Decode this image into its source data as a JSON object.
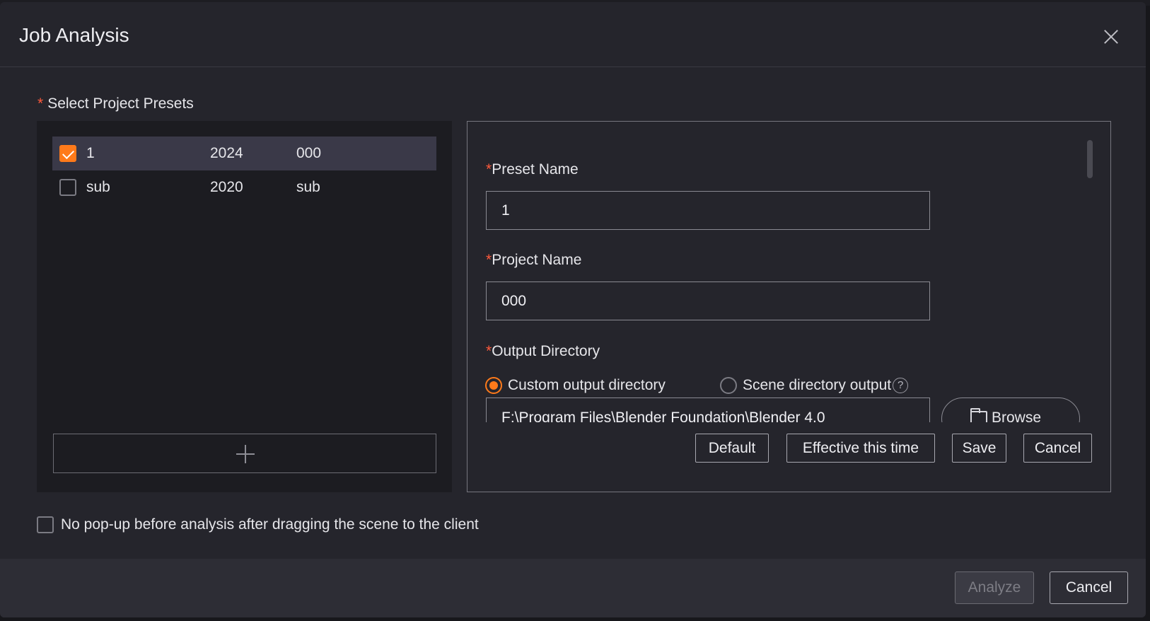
{
  "dialog": {
    "title": "Job Analysis",
    "close_icon": "close-icon"
  },
  "presets": {
    "section_label": "Select Project Presets",
    "required_marker": "*",
    "rows": [
      {
        "name": "1",
        "year": "2024",
        "project": "000",
        "checked": true
      },
      {
        "name": "sub",
        "year": "2020",
        "project": "sub",
        "checked": false
      }
    ],
    "add_icon": "plus-icon"
  },
  "editor": {
    "required_marker": "*",
    "preset_name_label": "Preset Name",
    "preset_name_value": "1",
    "project_name_label": "Project Name",
    "project_name_value": "000",
    "output_dir_label": "Output Directory",
    "radio_custom": "Custom output directory",
    "radio_scene": "Scene directory output",
    "help_glyph": "?",
    "output_path": "F:\\Program Files\\Blender Foundation\\Blender 4.0",
    "browse_label": "Browse",
    "buttons": {
      "default": "Default",
      "effective": "Effective this time",
      "save": "Save",
      "cancel": "Cancel"
    }
  },
  "options": {
    "no_popup_label": "No pop-up before analysis after dragging the scene to the client"
  },
  "footer": {
    "analyze": "Analyze",
    "cancel": "Cancel"
  },
  "colors": {
    "accent": "#ff7a1a",
    "required": "#ff5a3c",
    "background": "#25252c"
  }
}
